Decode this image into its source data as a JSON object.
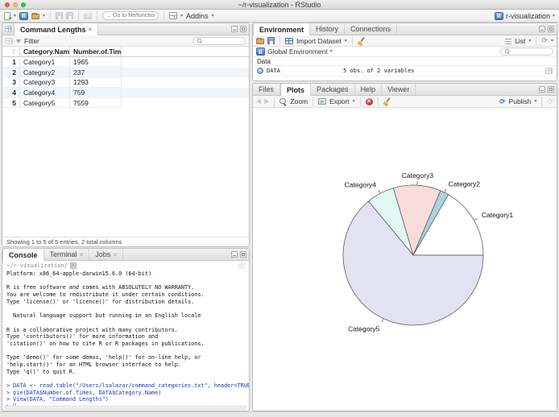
{
  "window": {
    "title": "~/r-visualization - RStudio"
  },
  "icons": {
    "caret": "▾",
    "close": "×",
    "back": "◀",
    "forward": "▶",
    "refresh": "⟳",
    "goto_arrow": "→"
  },
  "main_toolbar": {
    "goto_placeholder": "Go to file/function",
    "addins_label": "Addins",
    "project_label": "r-visualization"
  },
  "data_viewer": {
    "tab_title": "Command Lengths",
    "filter_label": "Filter",
    "table": {
      "columns": [
        "Category.Name",
        "Number.of.Times"
      ],
      "rows": [
        [
          "Category1",
          "1965"
        ],
        [
          "Category2",
          "237"
        ],
        [
          "Category3",
          "1293"
        ],
        [
          "Category4",
          "759"
        ],
        [
          "Category5",
          "7559"
        ]
      ]
    },
    "footer": "Showing 1 to 5 of 5 entries, 2 total columns"
  },
  "console": {
    "tabs": [
      "Console",
      "Terminal",
      "Jobs"
    ],
    "path": "~/r-visualization/",
    "lines": [
      {
        "text": "Platform: x86_64-apple-darwin15.6.0 (64-bit)",
        "type": "output"
      },
      {
        "text": "",
        "type": "output"
      },
      {
        "text": "R is free software and comes with ABSOLUTELY NO WARRANTY.",
        "type": "output"
      },
      {
        "text": "You are welcome to redistribute it under certain conditions.",
        "type": "output"
      },
      {
        "text": "Type 'license()' or 'licence()' for distribution details.",
        "type": "output"
      },
      {
        "text": "",
        "type": "output"
      },
      {
        "text": "  Natural language support but running in an English locale",
        "type": "output"
      },
      {
        "text": "",
        "type": "output"
      },
      {
        "text": "R is a collaborative project with many contributors.",
        "type": "output"
      },
      {
        "text": "Type 'contributors()' for more information and",
        "type": "output"
      },
      {
        "text": "'citation()' on how to cite R or R packages in publications.",
        "type": "output"
      },
      {
        "text": "",
        "type": "output"
      },
      {
        "text": "Type 'demo()' for some demos, 'help()' for on-line help, or",
        "type": "output"
      },
      {
        "text": "'help.start()' for an HTML browser interface to help.",
        "type": "output"
      },
      {
        "text": "Type 'q()' to quit R.",
        "type": "output"
      },
      {
        "text": "",
        "type": "output"
      },
      {
        "text": "> DATA <- read.table(\"/Users/lsalazar/command_categories.txt\", header=TRUE)",
        "type": "input"
      },
      {
        "text": "> pie(DATA$Number.of.Times, DATA$Category.Name)",
        "type": "input"
      },
      {
        "text": "> View(DATA, \"Command Lengths\")",
        "type": "input"
      },
      {
        "text": "> ",
        "type": "prompt"
      }
    ]
  },
  "environment": {
    "tabs": [
      "Environment",
      "History",
      "Connections"
    ],
    "import_label": "Import Dataset",
    "list_label": "List",
    "scope_label": "Global Environment",
    "section_label": "Data",
    "objects": [
      {
        "name": "DATA",
        "desc": "5 obs. of 2 variables"
      }
    ]
  },
  "plots": {
    "tabs": [
      "Files",
      "Plots",
      "Packages",
      "Help",
      "Viewer"
    ],
    "zoom_label": "Zoom",
    "export_label": "Export",
    "publish_label": "Publish"
  },
  "chart_data": {
    "type": "pie",
    "title": "",
    "categories": [
      "Category1",
      "Category2",
      "Category3",
      "Category4",
      "Category5"
    ],
    "values": [
      1965,
      237,
      1293,
      759,
      7559
    ],
    "colors": [
      "#FFFFFF",
      "#A9D3E3",
      "#F9DCD8",
      "#E1F7F4",
      "#E2E2F2"
    ],
    "stroke_color": "#4d4d4d",
    "start_angle_deg": 0,
    "direction": "counterclockwise",
    "legend": false
  }
}
